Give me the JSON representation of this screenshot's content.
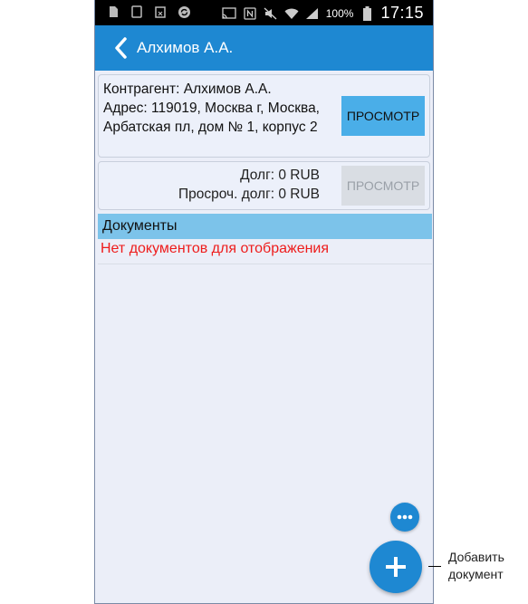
{
  "status_bar": {
    "battery": "100%",
    "time": "17:15"
  },
  "app_bar": {
    "title": "Алхимов А.А."
  },
  "counterparty_card": {
    "line1": "Контрагент: Алхимов А.А.",
    "line2": "Адрес: 119019, Москва г, Москва, Арбатская пл, дом № 1, корпус 2",
    "button_label": "ПРОСМОТР"
  },
  "debt_card": {
    "debt": "Долг: 0 RUB",
    "overdue_debt": "Просроч. долг: 0 RUB",
    "button_label": "ПРОСМОТР"
  },
  "documents": {
    "header": "Документы",
    "empty_message": "Нет документов для отображения"
  },
  "callout": {
    "line1": "Добавить",
    "line2": "документ"
  },
  "colors": {
    "primary": "#1e88d2",
    "section_header": "#7cc3ea",
    "error_text": "#ee1c1c",
    "background": "#ebeef8"
  },
  "icons": [
    "back-chevron-icon",
    "more-dots-icon",
    "plus-icon"
  ]
}
